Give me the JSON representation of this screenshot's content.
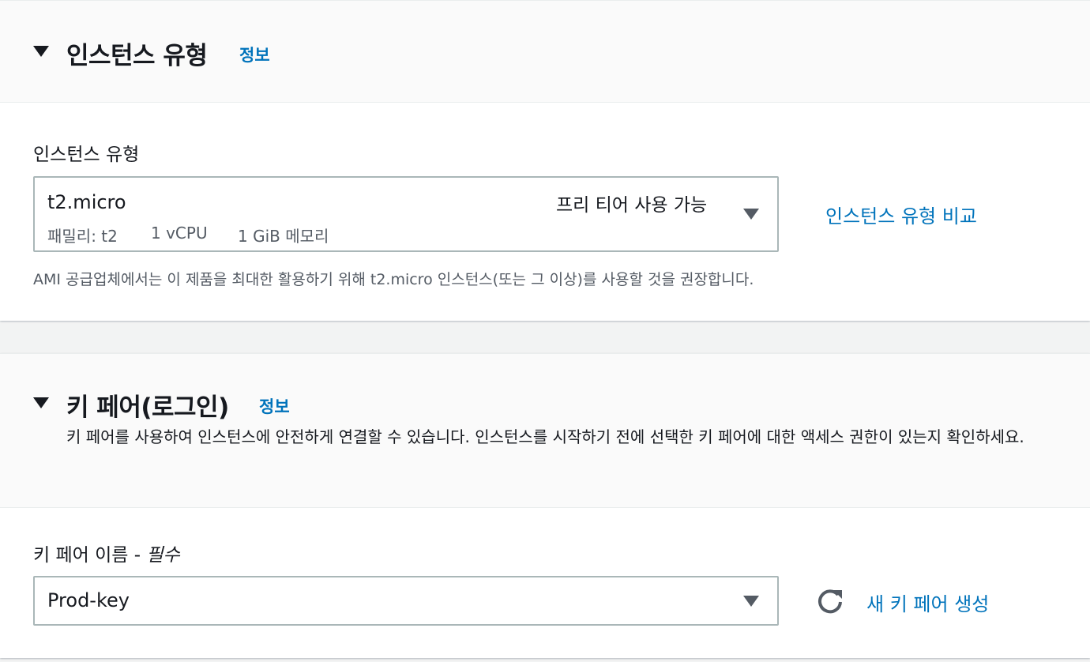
{
  "instance_type_section": {
    "title": "인스턴스 유형",
    "info_link": "정보",
    "field_label": "인스턴스 유형",
    "selected": {
      "value": "t2.micro",
      "tag": "프리 티어 사용 가능",
      "family": "패밀리: t2",
      "vcpu": "1 vCPU",
      "memory": "1 GiB 메모리"
    },
    "compare_link": "인스턴스 유형 비교",
    "help_text": "AMI 공급업체에서는 이 제품을 최대한 활용하기 위해 t2.micro 인스턴스(또는 그 이상)를 사용할 것을 권장합니다."
  },
  "key_pair_section": {
    "title": "키 페어(로그인)",
    "info_link": "정보",
    "description": "키 페어를 사용하여 인스턴스에 안전하게 연결할 수 있습니다. 인스턴스를 시작하기 전에 선택한 키 페어에 대한 액세스 권한이 있는지 확인하세요.",
    "field_label": "키 페어 이름 - ",
    "field_required": "필수",
    "selected_value": "Prod-key",
    "create_link": "새 키 페어 생성"
  },
  "colors": {
    "link": "#0073bb",
    "text": "#16191f",
    "secondary_text": "#545b64",
    "border": "#aab7b8",
    "header_bg": "#fafafa",
    "page_bg": "#f2f3f3"
  },
  "icons": {
    "section_toggle": "caret-down-icon",
    "select_dropdown": "caret-down-icon",
    "refresh": "refresh-icon"
  }
}
